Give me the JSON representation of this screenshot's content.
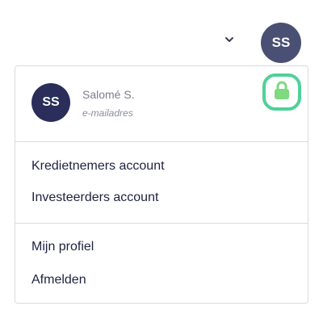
{
  "header": {
    "avatar_initials": "SS",
    "chevron_icon": "chevron-down-icon"
  },
  "dropdown": {
    "user": {
      "initials": "SS",
      "name": "Salomé S.",
      "email": "e-mailadres"
    },
    "lock_icon": "lock-icon",
    "accounts": [
      {
        "label": "Kredietnemers account"
      },
      {
        "label": "Investeerders account"
      }
    ],
    "profile": [
      {
        "label": "Mijn profiel"
      },
      {
        "label": "Afmelden"
      }
    ]
  },
  "colors": {
    "avatar_bg": "#4a5073",
    "avatar_dark_bg": "#2b2e5b",
    "lock": "#7ed97f",
    "highlight_ring": "#4fd19a",
    "text_dark": "#1f2240",
    "text_muted": "#7a7f8c"
  }
}
